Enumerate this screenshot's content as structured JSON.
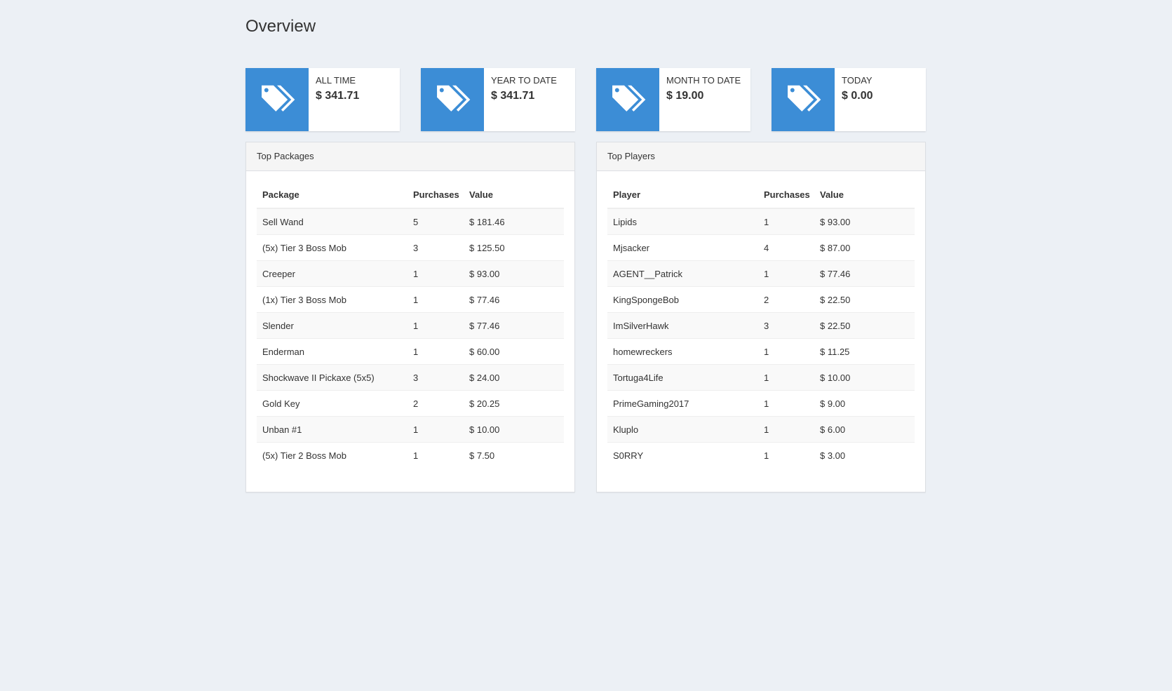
{
  "page": {
    "title": "Overview"
  },
  "stats": [
    {
      "label": "ALL TIME",
      "value": "$ 341.71",
      "icon": "tags-icon"
    },
    {
      "label": "YEAR TO DATE",
      "value": "$ 341.71",
      "icon": "tags-icon"
    },
    {
      "label": "MONTH TO DATE",
      "value": "$ 19.00",
      "icon": "tags-icon"
    },
    {
      "label": "TODAY",
      "value": "$ 0.00",
      "icon": "tags-icon"
    }
  ],
  "top_packages": {
    "title": "Top Packages",
    "headers": [
      "Package",
      "Purchases",
      "Value"
    ],
    "rows": [
      [
        "Sell Wand",
        "5",
        "$ 181.46"
      ],
      [
        "(5x) Tier 3 Boss Mob",
        "3",
        "$ 125.50"
      ],
      [
        "Creeper",
        "1",
        "$ 93.00"
      ],
      [
        "(1x) Tier 3 Boss Mob",
        "1",
        "$ 77.46"
      ],
      [
        "Slender",
        "1",
        "$ 77.46"
      ],
      [
        "Enderman",
        "1",
        "$ 60.00"
      ],
      [
        "Shockwave II Pickaxe (5x5)",
        "3",
        "$ 24.00"
      ],
      [
        "Gold Key",
        "2",
        "$ 20.25"
      ],
      [
        "Unban #1",
        "1",
        "$ 10.00"
      ],
      [
        "(5x) Tier 2 Boss Mob",
        "1",
        "$ 7.50"
      ]
    ]
  },
  "top_players": {
    "title": "Top Players",
    "headers": [
      "Player",
      "Purchases",
      "Value"
    ],
    "rows": [
      [
        "Lipids",
        "1",
        "$ 93.00"
      ],
      [
        "Mjsacker",
        "4",
        "$ 87.00"
      ],
      [
        "AGENT__Patrick",
        "1",
        "$ 77.46"
      ],
      [
        "KingSpongeBob",
        "2",
        "$ 22.50"
      ],
      [
        "ImSilverHawk",
        "3",
        "$ 22.50"
      ],
      [
        "homewreckers",
        "1",
        "$ 11.25"
      ],
      [
        "Tortuga4Life",
        "1",
        "$ 10.00"
      ],
      [
        "PrimeGaming2017",
        "1",
        "$ 9.00"
      ],
      [
        "Kluplo",
        "1",
        "$ 6.00"
      ],
      [
        "S0RRY",
        "1",
        "$ 3.00"
      ]
    ]
  },
  "colors": {
    "accent": "#3c8dd6",
    "background": "#ecf0f5"
  }
}
